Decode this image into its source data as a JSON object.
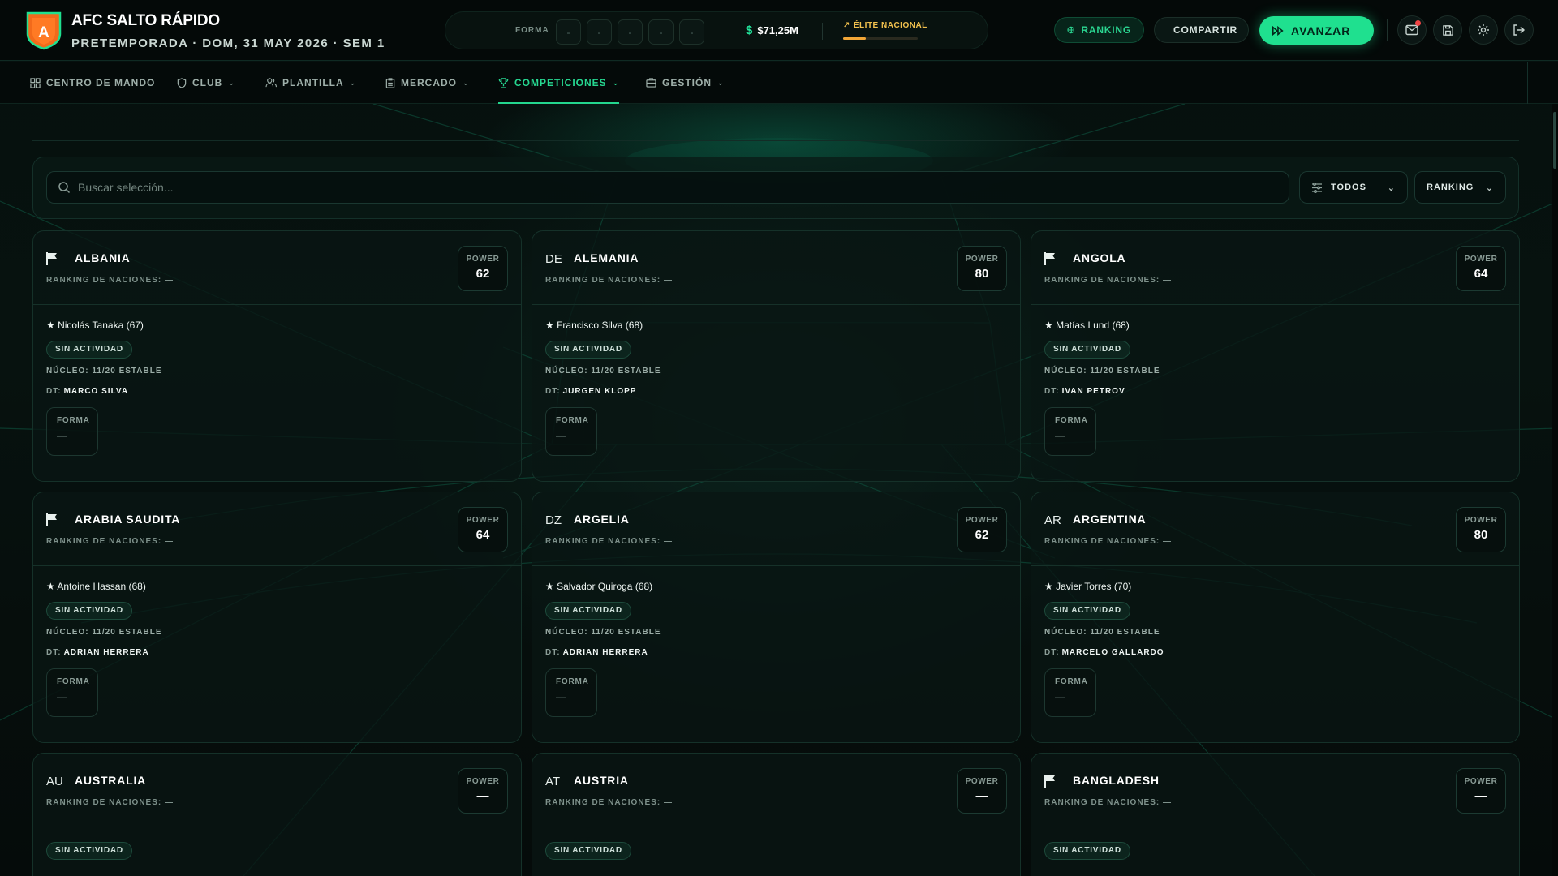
{
  "header": {
    "club_name": "AFC SALTO RÁPIDO",
    "crest_letter": "A",
    "subtitle": "PRETEMPORADA · DOM, 31 MAY 2026 · SEM 1",
    "forma_label": "FORMA",
    "forma_slots": [
      "-",
      "-",
      "-",
      "-",
      "-"
    ],
    "money_symbol": "$",
    "money": "$71,25M",
    "elite_label": "ÉLITE NACIONAL",
    "elite_progress": 0.3,
    "buttons": {
      "ranking": "RANKING",
      "compartir": "COMPARTIR",
      "avanzar": "AVANZAR"
    },
    "icons": [
      "mail-icon",
      "save-icon",
      "gear-icon",
      "logout-icon"
    ]
  },
  "nav": {
    "items": [
      {
        "label": "CENTRO DE MANDO",
        "icon": "grid-icon",
        "has_menu": false
      },
      {
        "label": "CLUB",
        "icon": "shield-icon",
        "has_menu": true
      },
      {
        "label": "PLANTILLA",
        "icon": "users-icon",
        "has_menu": true
      },
      {
        "label": "MERCADO",
        "icon": "clipboard-icon",
        "has_menu": true
      },
      {
        "label": "COMPETICIONES",
        "icon": "trophy-icon",
        "has_menu": true,
        "active": true
      },
      {
        "label": "GESTIÓN",
        "icon": "briefcase-icon",
        "has_menu": true
      }
    ]
  },
  "filters": {
    "search_placeholder": "Buscar selección...",
    "group_select": "TODOS",
    "sort_select": "RANKING"
  },
  "card_labels": {
    "power": "POWER",
    "ranking": "RANKING DE NACIONES:",
    "no_value": "—",
    "nucleo_prefix": "NÚCLEO:",
    "dt_prefix": "DT:",
    "forma": "FORMA",
    "badge": "SIN ACTIVIDAD",
    "star": "★"
  },
  "nations": [
    {
      "name": "ALBANIA",
      "flag": "flag-icon",
      "code": "",
      "power": "62",
      "ranking": "—",
      "star": "Nicolás Tanaka (67)",
      "status": "SIN ACTIVIDAD",
      "nucleo": "11/20 ESTABLE",
      "dt": "MARCO SILVA",
      "forma": "—"
    },
    {
      "name": "ALEMANIA",
      "flag": "",
      "code": "DE",
      "power": "80",
      "ranking": "—",
      "star": "Francisco Silva (68)",
      "status": "SIN ACTIVIDAD",
      "nucleo": "11/20 ESTABLE",
      "dt": "JURGEN KLOPP",
      "forma": "—"
    },
    {
      "name": "ANGOLA",
      "flag": "flag-icon",
      "code": "",
      "power": "64",
      "ranking": "—",
      "star": "Matías Lund (68)",
      "status": "SIN ACTIVIDAD",
      "nucleo": "11/20 ESTABLE",
      "dt": "IVAN PETROV",
      "forma": "—"
    },
    {
      "name": "ARABIA SAUDITA",
      "flag": "flag-icon",
      "code": "",
      "power": "64",
      "ranking": "—",
      "star": "Antoine Hassan (68)",
      "status": "SIN ACTIVIDAD",
      "nucleo": "11/20 ESTABLE",
      "dt": "ADRIAN HERRERA",
      "forma": "—"
    },
    {
      "name": "ARGELIA",
      "flag": "",
      "code": "DZ",
      "power": "62",
      "ranking": "—",
      "star": "Salvador Quiroga (68)",
      "status": "SIN ACTIVIDAD",
      "nucleo": "11/20 ESTABLE",
      "dt": "ADRIAN HERRERA",
      "forma": "—"
    },
    {
      "name": "ARGENTINA",
      "flag": "",
      "code": "AR",
      "power": "80",
      "ranking": "—",
      "star": "Javier Torres (70)",
      "status": "SIN ACTIVIDAD",
      "nucleo": "11/20 ESTABLE",
      "dt": "MARCELO GALLARDO",
      "forma": "—"
    },
    {
      "name": "AUSTRALIA",
      "flag": "",
      "code": "AU",
      "power": "—",
      "ranking": "—",
      "star": "",
      "status": "SIN ACTIVIDAD",
      "nucleo": "",
      "dt": "",
      "forma": ""
    },
    {
      "name": "AUSTRIA",
      "flag": "",
      "code": "AT",
      "power": "—",
      "ranking": "—",
      "star": "",
      "status": "SIN ACTIVIDAD",
      "nucleo": "",
      "dt": "",
      "forma": ""
    },
    {
      "name": "BANGLADESH",
      "flag": "flag-icon",
      "code": "",
      "power": "—",
      "ranking": "—",
      "star": "",
      "status": "SIN ACTIVIDAD",
      "nucleo": "",
      "dt": "",
      "forma": ""
    }
  ],
  "colors": {
    "accent": "#1fe08f",
    "elite": "#f2c14e",
    "background": "#050b0a"
  }
}
